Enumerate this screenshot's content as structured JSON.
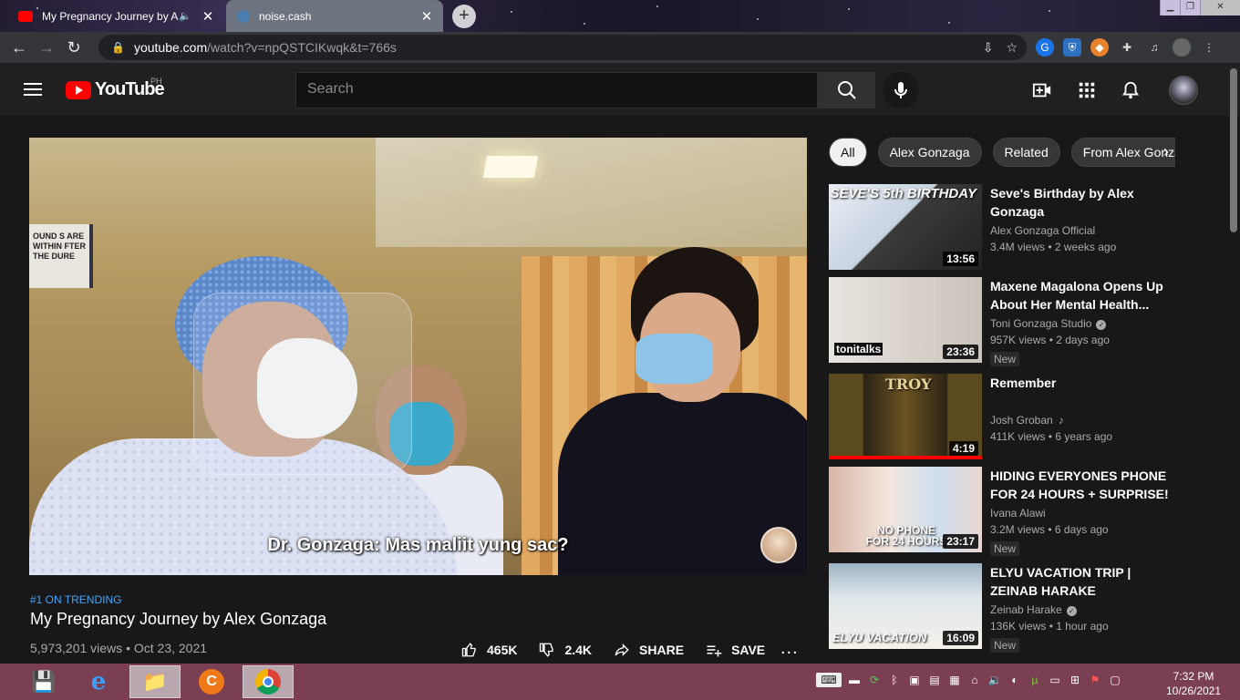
{
  "browser": {
    "tabs": [
      {
        "title": "My Pregnancy Journey by Alex Gonzaga - YouTube",
        "active": true
      },
      {
        "title": "noise.cash",
        "active": false
      }
    ],
    "url": {
      "host": "youtube.com",
      "path": "/watch?v=npQSTCIKwqk&t=766s"
    }
  },
  "youtube": {
    "logo_text": "YouTube",
    "country_code": "PH",
    "search_placeholder": "Search"
  },
  "video": {
    "subtitle": "Dr. Gonzaga: Mas maliit yung sac?",
    "sign_text": "OUND S ARE WITHIN FTER THE DURE",
    "trending": "#1 ON TRENDING",
    "title": "My Pregnancy Journey by Alex Gonzaga",
    "views_date": "5,973,201 views • Oct 23, 2021",
    "likes": "465K",
    "dislikes": "2.4K",
    "share_label": "SHARE",
    "save_label": "SAVE",
    "more": "..."
  },
  "chips": [
    "All",
    "Alex Gonzaga",
    "Related",
    "From Alex Gonzaga"
  ],
  "recommendations": [
    {
      "title": "Seve's Birthday by Alex Gonzaga",
      "channel": "Alex Gonzaga Official",
      "verified": false,
      "meta": "3.4M views • 2 weeks ago",
      "duration": "13:56",
      "thumb_caption": "SEVE'S 5th BIRTHDAY",
      "badge": ""
    },
    {
      "title": "Maxene Magalona Opens Up About Her Mental Health...",
      "channel": "Toni Gonzaga Studio",
      "verified": true,
      "meta": "957K views • 2 days ago",
      "duration": "23:36",
      "thumb_caption": "tonitalks",
      "badge": "New"
    },
    {
      "title": "Remember",
      "channel": "Josh Groban",
      "verified": false,
      "music": true,
      "meta": "411K views • 6 years ago",
      "duration": "4:19",
      "thumb_caption": "TROY",
      "badge": "",
      "progress": 1.0
    },
    {
      "title": "HIDING EVERYONES PHONE FOR 24 HOURS + SURPRISE! |...",
      "channel": "Ivana Alawi",
      "verified": false,
      "meta": "3.2M views • 6 days ago",
      "duration": "23:17",
      "thumb_caption": "NO PHONE FOR 24 HOURS",
      "badge": "New"
    },
    {
      "title": "ELYU VACATION TRIP | ZEINAB HARAKE",
      "channel": "Zeinab Harake",
      "verified": true,
      "meta": "136K views • 1 hour ago",
      "duration": "16:09",
      "thumb_caption": "ELYU VACATION",
      "badge": "New"
    }
  ],
  "taskbar": {
    "time": "7:32 PM",
    "date": "10/26/2021"
  },
  "colors": {
    "yt_red": "#ff0000",
    "link_blue": "#3ea6ff",
    "taskbar": "#7a3f52",
    "bg": "#181818"
  }
}
